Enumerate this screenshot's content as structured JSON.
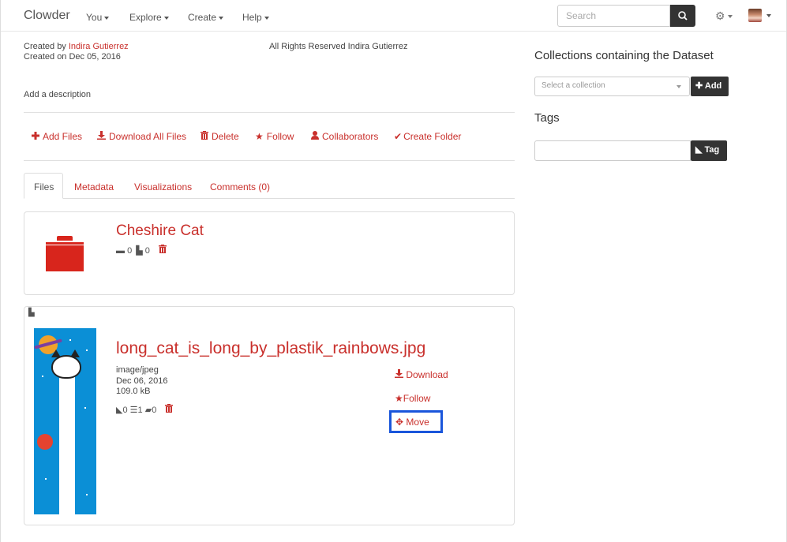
{
  "nav": {
    "brand": "Clowder",
    "items": [
      "You",
      "Explore",
      "Create",
      "Help"
    ],
    "search_placeholder": "Search"
  },
  "dataset": {
    "created_by_prefix": "Created by ",
    "author": "Indira Gutierrez",
    "created_on": "Created on Dec 05, 2016",
    "rights": "All Rights Reserved Indira Gutierrez",
    "description_prompt": "Add a description"
  },
  "actions": [
    {
      "icon": "plus",
      "label": "Add Files"
    },
    {
      "icon": "download",
      "label": "Download All Files"
    },
    {
      "icon": "trash",
      "label": "Delete"
    },
    {
      "icon": "star",
      "label": "Follow"
    },
    {
      "icon": "user",
      "label": "Collaborators"
    },
    {
      "icon": "check",
      "label": "Create Folder"
    }
  ],
  "tabs": [
    "Files",
    "Metadata",
    "Visualizations",
    "Comments (0)"
  ],
  "folder": {
    "name": "Cheshire Cat",
    "folders": "0",
    "files": "0"
  },
  "file": {
    "name": "long_cat_is_long_by_plastik_rainbows.jpg",
    "type": "image/jpeg",
    "date": "Dec 06, 2016",
    "size": "109.0 kB",
    "tags": "0",
    "metadata": "1",
    "comments": "0",
    "download": "Download",
    "follow": "Follow",
    "move": "Move"
  },
  "sidebar": {
    "collections_heading": "Collections containing the Dataset",
    "select_placeholder": "Select a collection",
    "add_label": "Add",
    "tags_heading": "Tags",
    "tag_label": "Tag"
  },
  "colors": {
    "accent_red": "#c9302c",
    "folder_red": "#d8251c",
    "highlight_blue": "#1a56db",
    "dark_button": "#333333"
  }
}
